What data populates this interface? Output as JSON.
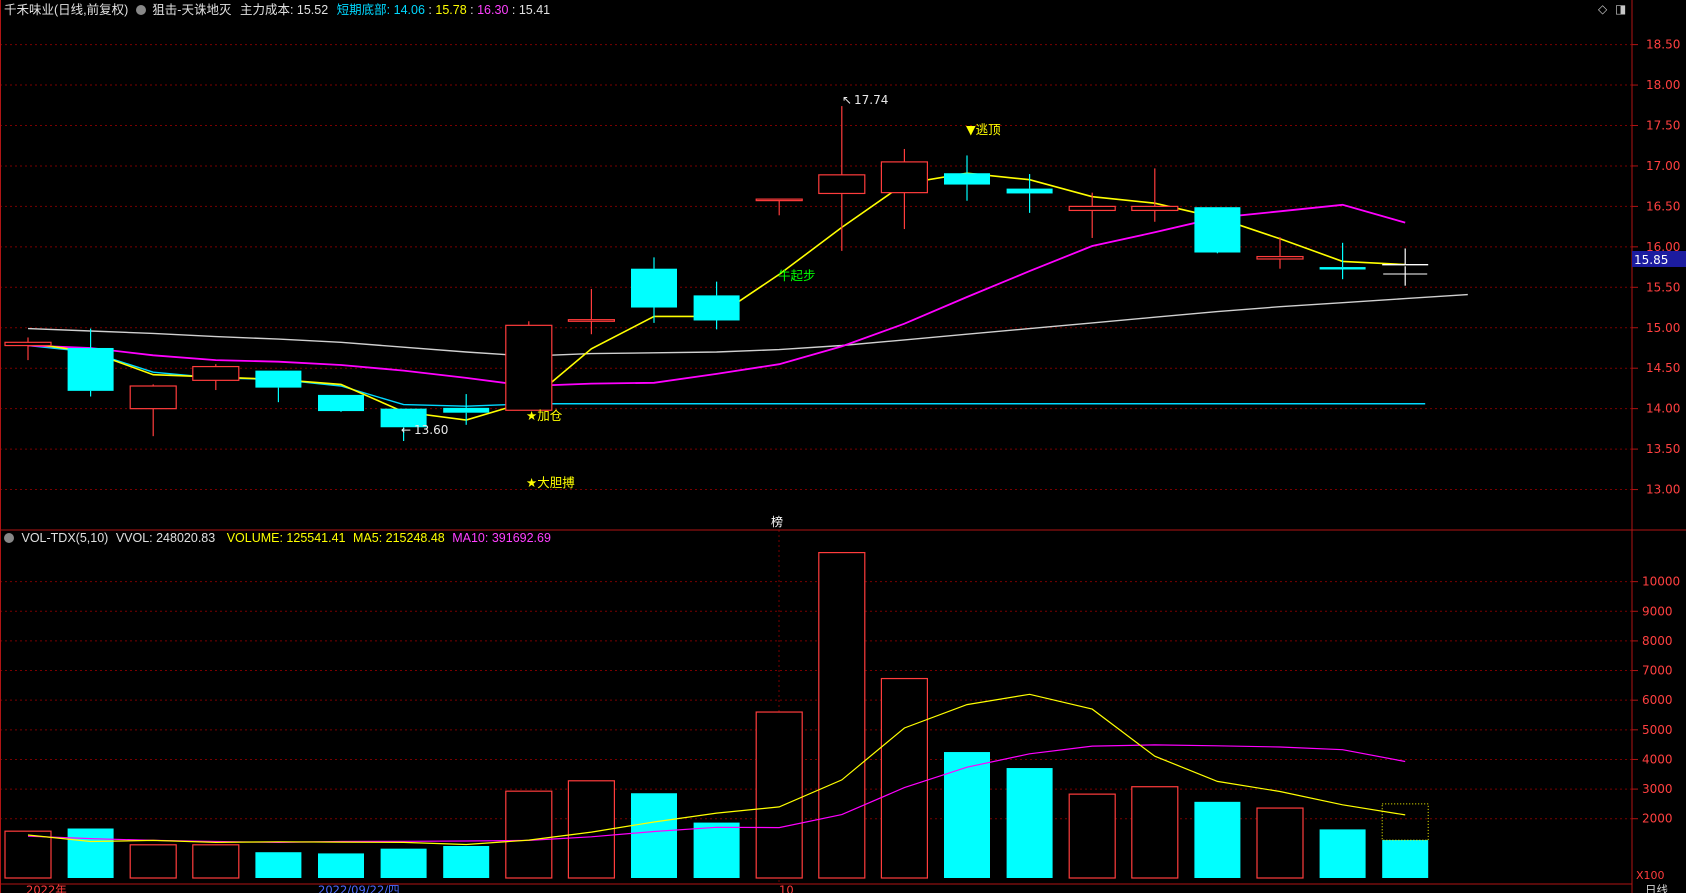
{
  "colors": {
    "background": "#000000",
    "grid": "#7a0000",
    "up": "#ff3c3c",
    "down": "#00ffff",
    "ma_yellow": "#ffff00",
    "ma_magenta": "#ff00ff",
    "ma_white": "#d0d0d0",
    "support_cyan": "#00d8ff",
    "label_white": "#ffffff",
    "label_green": "#00ff00",
    "current_price_bg": "#1c1ca0"
  },
  "header": {
    "stock_title": "千禾味业(日线,前复权)",
    "indicator_name": "狙击-天诛地灭",
    "cost_label": "主力成本:",
    "cost_value": "15.52",
    "bottom_label": "短期底部:",
    "v1": "14.06",
    "v2": "15.78",
    "v3": "16.30",
    "v4": "15.41",
    "sep": ":"
  },
  "vol_header": {
    "name": "VOL-TDX(5,10)",
    "vvol": "VVOL: 248020.83",
    "volume": "VOLUME: 125541.41",
    "ma5": "MA5: 215248.48",
    "ma10": "MA10: 391692.69"
  },
  "price_axis": [
    "18.50",
    "18.00",
    "17.50",
    "17.00",
    "16.50",
    "16.00",
    "15.50",
    "15.00",
    "14.50",
    "14.00",
    "13.50",
    "13.00"
  ],
  "current_price": "15.85",
  "vol_axis": [
    "10000",
    "9000",
    "8000",
    "7000",
    "6000",
    "5000",
    "4000",
    "3000",
    "2000"
  ],
  "vol_unit": "X100",
  "date_labels": {
    "left": "2022年",
    "mid": "2022/09/22/四",
    "month": "10",
    "period": "日线"
  },
  "annotations": {
    "high": "17.74",
    "low": "13.60",
    "escape": "▼逃顶",
    "bull": "牛起步",
    "add": "★加仓",
    "bold": "★大胆搏",
    "bang": "榜"
  },
  "chart_data": [
    {
      "type": "candlestick",
      "title": "千禾味业(日线,前复权)",
      "ylim": [
        12.5,
        18.8
      ],
      "candles": [
        {
          "o": 14.78,
          "h": 14.88,
          "l": 14.6,
          "c": 14.82
        },
        {
          "o": 14.75,
          "h": 14.99,
          "l": 14.15,
          "c": 14.22
        },
        {
          "o": 14.0,
          "h": 14.3,
          "l": 13.66,
          "c": 14.28
        },
        {
          "o": 14.35,
          "h": 14.55,
          "l": 14.23,
          "c": 14.52
        },
        {
          "o": 14.47,
          "h": 14.47,
          "l": 14.08,
          "c": 14.26
        },
        {
          "o": 14.17,
          "h": 14.17,
          "l": 13.96,
          "c": 13.97
        },
        {
          "o": 14.0,
          "h": 14.0,
          "l": 13.6,
          "c": 13.77
        },
        {
          "o": 14.01,
          "h": 14.18,
          "l": 13.8,
          "c": 13.95
        },
        {
          "o": 13.98,
          "h": 15.08,
          "l": 13.98,
          "c": 15.03
        },
        {
          "o": 15.08,
          "h": 15.48,
          "l": 14.92,
          "c": 15.1
        },
        {
          "o": 15.73,
          "h": 15.87,
          "l": 15.06,
          "c": 15.25
        },
        {
          "o": 15.4,
          "h": 15.57,
          "l": 14.98,
          "c": 15.09
        },
        {
          "o": 16.59,
          "h": 16.59,
          "l": 16.39,
          "c": 16.59
        },
        {
          "o": 16.66,
          "h": 17.74,
          "l": 15.95,
          "c": 16.89
        },
        {
          "o": 16.67,
          "h": 17.21,
          "l": 16.22,
          "c": 17.05
        },
        {
          "o": 16.91,
          "h": 17.13,
          "l": 16.57,
          "c": 16.77
        },
        {
          "o": 16.72,
          "h": 16.9,
          "l": 16.42,
          "c": 16.66
        },
        {
          "o": 16.45,
          "h": 16.67,
          "l": 16.11,
          "c": 16.5
        },
        {
          "o": 16.45,
          "h": 16.97,
          "l": 16.31,
          "c": 16.5
        },
        {
          "o": 16.49,
          "h": 16.49,
          "l": 15.92,
          "c": 15.93
        },
        {
          "o": 15.85,
          "h": 16.12,
          "l": 15.73,
          "c": 15.88
        },
        {
          "o": 15.75,
          "h": 16.05,
          "l": 15.6,
          "c": 15.72
        },
        {
          "o": 15.78,
          "h": 15.98,
          "l": 15.52,
          "c": 15.76
        }
      ],
      "ma_yellow": [
        14.81,
        14.7,
        14.42,
        14.39,
        14.36,
        14.3,
        13.96,
        13.86,
        14.09,
        14.74,
        15.14,
        15.14,
        15.66,
        16.24,
        16.78,
        16.91,
        16.83,
        16.62,
        16.54,
        16.36,
        16.1,
        15.82,
        15.78
      ],
      "ma_magenta": [
        14.78,
        14.75,
        14.66,
        14.6,
        14.58,
        14.54,
        14.47,
        14.38,
        14.28,
        14.31,
        14.32,
        14.43,
        14.55,
        14.77,
        15.05,
        15.38,
        15.7,
        16.01,
        16.18,
        16.36,
        16.44,
        16.52,
        16.3
      ],
      "ma_white": [
        14.99,
        14.96,
        14.93,
        14.89,
        14.86,
        14.82,
        14.76,
        14.7,
        14.65,
        14.68,
        14.69,
        14.7,
        14.73,
        14.78,
        14.85,
        14.92,
        14.99,
        15.06,
        15.13,
        15.2,
        15.26,
        15.31,
        15.36,
        15.41
      ],
      "support_line": 14.06
    },
    {
      "type": "bar",
      "title": "VOL-TDX(5,10)",
      "ylim": [
        0,
        11000
      ],
      "values": [
        1580,
        1670,
        1120,
        1120,
        870,
        830,
        990,
        1080,
        2930,
        3280,
        2860,
        1870,
        5600,
        10980,
        6730,
        4250,
        3710,
        2830,
        3080,
        2570,
        2360,
        1640,
        1280
      ],
      "ma5": [
        1450,
        1230,
        1270,
        1200,
        1220,
        1210,
        1200,
        1130,
        1280,
        1550,
        1890,
        2190,
        2400,
        3310,
        5060,
        5850,
        6200,
        5700,
        4110,
        3260,
        2920,
        2470,
        2130
      ],
      "ma10": [
        1410,
        1330,
        1270,
        1230,
        1200,
        1230,
        1240,
        1250,
        1270,
        1390,
        1570,
        1710,
        1700,
        2140,
        3050,
        3740,
        4190,
        4450,
        4490,
        4460,
        4420,
        4330,
        3930
      ]
    }
  ]
}
